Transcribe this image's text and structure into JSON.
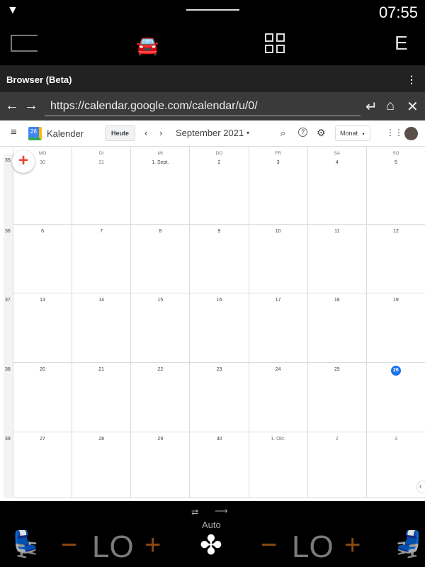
{
  "status": {
    "time": "07:55"
  },
  "nav": {
    "icons": [
      "camera-icon",
      "car-icon",
      "apps-grid-icon"
    ],
    "profile": "E"
  },
  "browser": {
    "title": "Browser (Beta)",
    "url": "https://calendar.google.com/calendar/u/0/"
  },
  "calendar": {
    "app_name": "Kalender",
    "logo_day": "26",
    "today": "Heute",
    "month": "September 2021",
    "view": "Monat",
    "weekdays": [
      "MO",
      "DI",
      "MI",
      "DO",
      "FR",
      "SA",
      "SO"
    ],
    "weeks": [
      {
        "num": "35",
        "days": [
          "30",
          "31",
          "1. Sept.",
          "2",
          "3",
          "4",
          "5"
        ]
      },
      {
        "num": "36",
        "days": [
          "6",
          "7",
          "8",
          "9",
          "10",
          "11",
          "12"
        ]
      },
      {
        "num": "37",
        "days": [
          "13",
          "14",
          "15",
          "16",
          "17",
          "18",
          "19"
        ]
      },
      {
        "num": "38",
        "days": [
          "20",
          "21",
          "22",
          "23",
          "24",
          "25",
          "26"
        ]
      },
      {
        "num": "39",
        "days": [
          "27",
          "28",
          "29",
          "30",
          "1. Okt.",
          "2",
          "3"
        ]
      }
    ],
    "current_day": "26"
  },
  "climate": {
    "mode": "Auto",
    "left_temp": "LO",
    "right_temp": "LO",
    "minus": "−",
    "plus": "+"
  },
  "colors": {
    "accent": "#1a73e8",
    "climate_control": "#8a4a10"
  }
}
